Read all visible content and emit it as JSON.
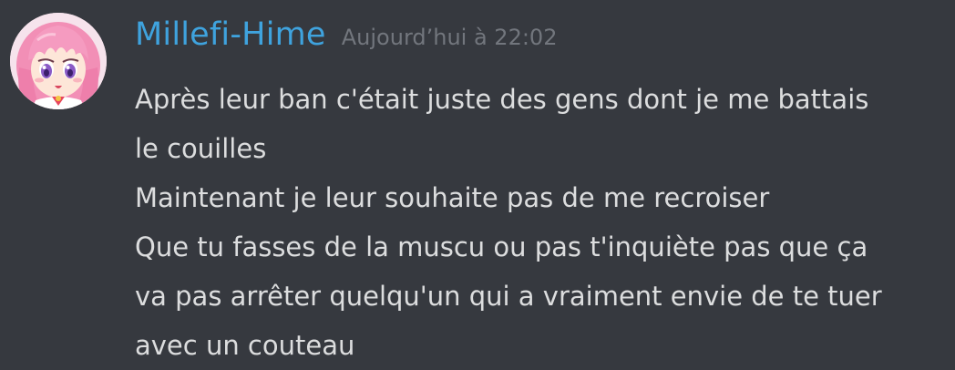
{
  "message": {
    "author": "Millefi-Hime",
    "timestamp": "Aujourd’hui à 22:02",
    "avatar_icon": "anime-girl-pink-hair-avatar",
    "lines": [
      "Après leur ban c'était juste des gens dont je me battais",
      "le couilles",
      "Maintenant je leur souhaite pas de me recroiser",
      "Que tu fasses de la muscu ou pas t'inquiète pas que ça",
      "va pas arrêter quelqu'un qui a vraiment envie de te tuer",
      "avec un couteau"
    ]
  },
  "colors": {
    "background": "#36393f",
    "username": "#3fa3de",
    "timestamp": "#72767d",
    "text": "#dcddde"
  }
}
